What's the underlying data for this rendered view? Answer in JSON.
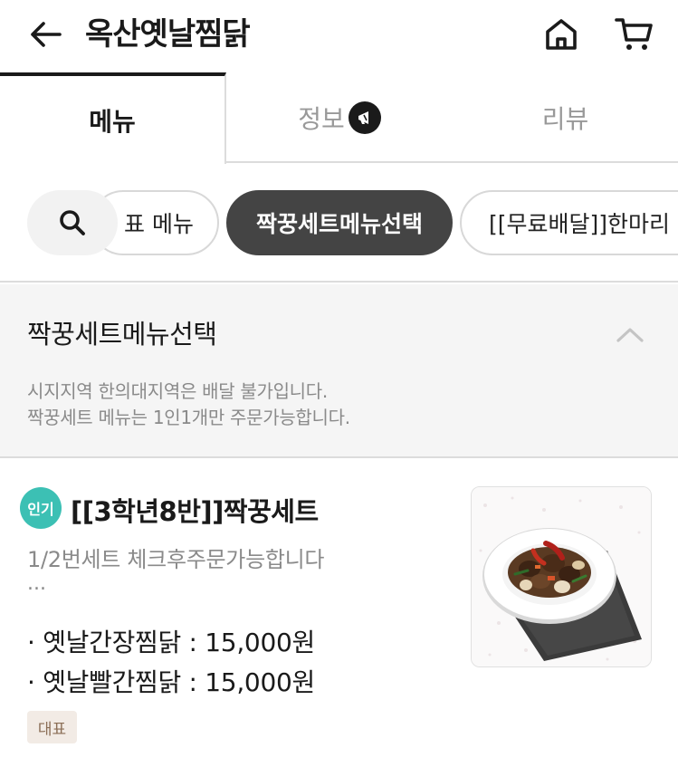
{
  "header": {
    "title": "옥산옛날찜닭",
    "back_icon": "back-arrow-icon",
    "home_icon": "home-icon",
    "cart_icon": "cart-icon"
  },
  "tabs": [
    {
      "label": "메뉴",
      "active": true
    },
    {
      "label": "정보",
      "active": false,
      "badge_icon": "megaphone-icon"
    },
    {
      "label": "리뷰",
      "active": false
    }
  ],
  "category_chips": {
    "search_icon": "search-icon",
    "items": [
      {
        "label": "표 메뉴",
        "active": false
      },
      {
        "label": "짝꿍세트메뉴선택",
        "active": true
      },
      {
        "label": "[[무료배달]]한마리",
        "active": false
      }
    ]
  },
  "section": {
    "title": "짝꿍세트메뉴선택",
    "description_lines": [
      "시지지역 한의대지역은 배달 불가입니다.",
      "짝꿍세트 메뉴는 1인1개만 주문가능합니다."
    ],
    "collapse_icon": "chevron-up-icon"
  },
  "menu_item": {
    "badge": "인기",
    "name": "[[3학년8반]]짝꿍세트",
    "description": "1/2번세트 체크후주문가능합니다",
    "ellipsis": "...",
    "options": [
      "· 옛날간장찜닭 : 15,000원",
      "· 옛날빨간찜닭 : 15,000원"
    ],
    "tag": "대표"
  },
  "colors": {
    "active_chip": "#444444",
    "popular_badge": "#3cc0b4",
    "rep_badge_bg": "#f2ebe5",
    "rep_badge_text": "#8a6d55",
    "section_bg": "#f5f5f5"
  }
}
